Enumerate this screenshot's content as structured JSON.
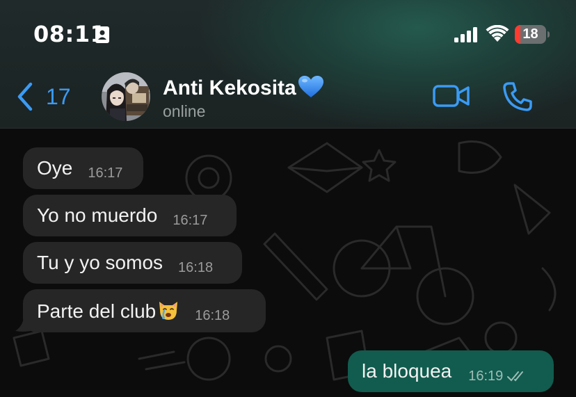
{
  "status_bar": {
    "time": "08:11",
    "battery_level": "18",
    "battery_fraction": 0.18,
    "icons": [
      "focus-id-icon",
      "cellular-signal-icon",
      "wifi-icon",
      "battery-icon"
    ]
  },
  "header": {
    "back_count": "17",
    "contact_name": "Anti Kekosita",
    "contact_status": "online",
    "icons": [
      "back-chevron-icon",
      "blue-heart-icon",
      "video-camera-icon",
      "phone-icon"
    ],
    "accent_color": "#3a9bf5"
  },
  "messages": [
    {
      "direction": "incoming",
      "text": "Oye",
      "time": "16:17"
    },
    {
      "direction": "incoming",
      "text": "Yo no muerdo",
      "time": "16:17"
    },
    {
      "direction": "incoming",
      "text": "Tu y yo somos",
      "time": "16:18"
    },
    {
      "direction": "incoming",
      "text": "Parte del club",
      "emoji": "crying-cat-face-icon",
      "time": "16:18"
    },
    {
      "direction": "outgoing",
      "text": "la bloquea",
      "time": "16:19",
      "status": "read-ticks-icon"
    }
  ],
  "colors": {
    "incoming_bubble": "#262626",
    "outgoing_bubble": "#115c4e",
    "battery_low": "#ff3b30"
  }
}
